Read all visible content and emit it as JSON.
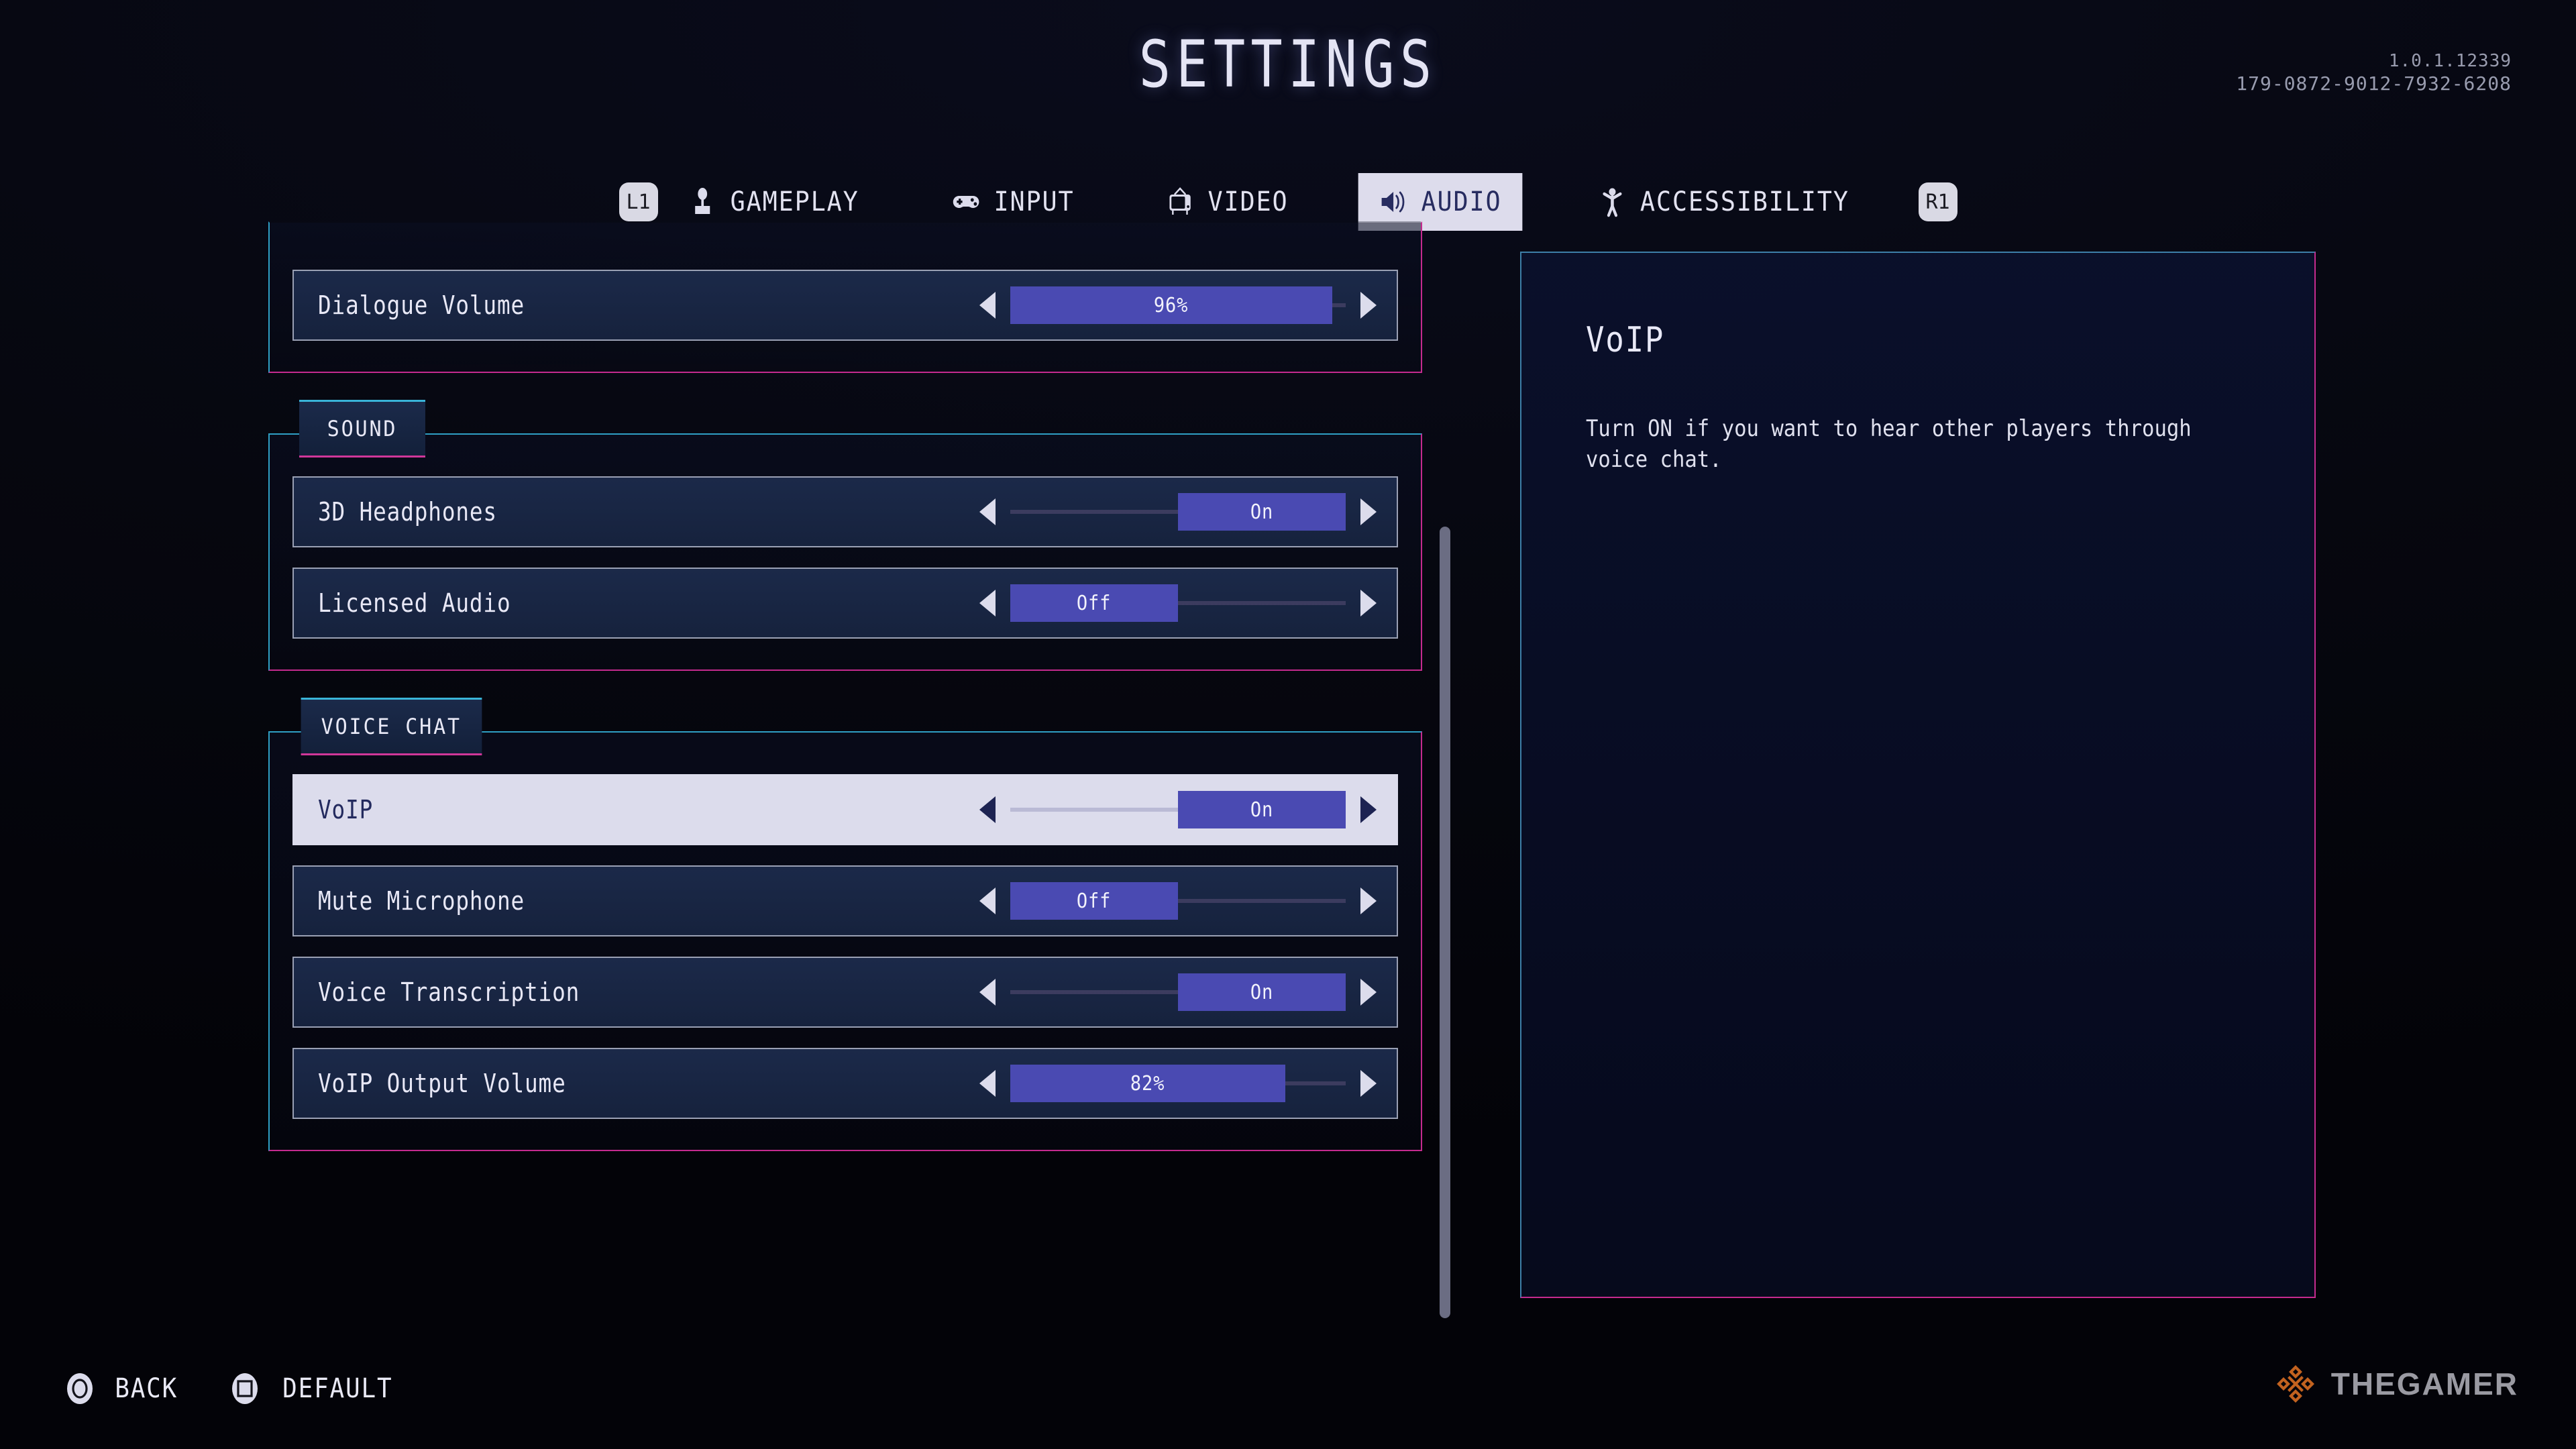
{
  "header": {
    "title": "SETTINGS",
    "version": "1.0.1.12339",
    "session_id": "179-0872-9012-7932-6208"
  },
  "tabs": {
    "prev_bumper": "L1",
    "next_bumper": "R1",
    "items": [
      {
        "label": "GAMEPLAY",
        "icon": "joystick-icon",
        "active": false
      },
      {
        "label": "INPUT",
        "icon": "gamepad-icon",
        "active": false
      },
      {
        "label": "VIDEO",
        "icon": "television-icon",
        "active": false
      },
      {
        "label": "AUDIO",
        "icon": "speaker-icon",
        "active": true
      },
      {
        "label": "ACCESSIBILITY",
        "icon": "accessibility-person-icon",
        "active": false
      }
    ]
  },
  "settings": {
    "groups": [
      {
        "title": "",
        "rows": [
          {
            "label": "Dialogue Volume",
            "type": "percent",
            "value": "96%",
            "percent": 96,
            "selected": false
          }
        ]
      },
      {
        "title": "SOUND",
        "rows": [
          {
            "label": "3D Headphones",
            "type": "toggle",
            "value": "On",
            "selected": false
          },
          {
            "label": "Licensed Audio",
            "type": "toggle",
            "value": "Off",
            "selected": false
          }
        ]
      },
      {
        "title": "VOICE CHAT",
        "rows": [
          {
            "label": "VoIP",
            "type": "toggle",
            "value": "On",
            "selected": true
          },
          {
            "label": "Mute Microphone",
            "type": "toggle",
            "value": "Off",
            "selected": false
          },
          {
            "label": "Voice Transcription",
            "type": "toggle",
            "value": "On",
            "selected": false
          },
          {
            "label": "VoIP Output Volume",
            "type": "percent",
            "value": "82%",
            "percent": 82,
            "selected": false
          }
        ]
      }
    ]
  },
  "info_panel": {
    "title": "VoIP",
    "description": "Turn ON if you want to hear other players through voice chat."
  },
  "footer": {
    "buttons": [
      {
        "label": "BACK",
        "icon": "circle-button-icon"
      },
      {
        "label": "DEFAULT",
        "icon": "square-button-icon"
      }
    ]
  },
  "watermark": {
    "text": "THEGAMER",
    "logo_color": "#c2621f"
  },
  "colors": {
    "accent_cyan": "#2f9fc4",
    "accent_magenta": "#c42a8e",
    "fill_purple": "#4a4ab2",
    "highlight_light": "#dcdcec",
    "highlight_dark_text": "#232a5e"
  }
}
